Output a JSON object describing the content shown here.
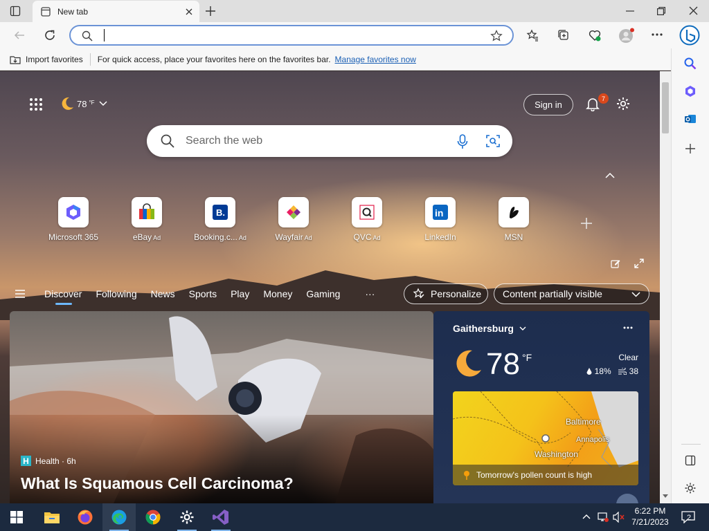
{
  "browser": {
    "tab_title": "New tab",
    "address_placeholder": "",
    "favorites_bar": {
      "import_label": "Import favorites",
      "hint": "For quick access, place your favorites here on the favorites bar.",
      "manage_link": "Manage favorites now"
    }
  },
  "newtab": {
    "weather_chip": "78",
    "weather_unit": "°F",
    "sign_in": "Sign in",
    "notification_count": "7",
    "search_placeholder": "Search the web",
    "quick_links": [
      {
        "name": "Microsoft 365",
        "ad": ""
      },
      {
        "name": "eBay",
        "ad": "Ad"
      },
      {
        "name": "Booking.c...",
        "ad": "Ad"
      },
      {
        "name": "Wayfair",
        "ad": "Ad"
      },
      {
        "name": "QVC",
        "ad": "Ad"
      },
      {
        "name": "LinkedIn",
        "ad": ""
      },
      {
        "name": "MSN",
        "ad": ""
      }
    ],
    "nav": [
      "Discover",
      "Following",
      "News",
      "Sports",
      "Play",
      "Money",
      "Gaming"
    ],
    "more": "···",
    "personalize": "Personalize",
    "content_visibility": "Content partially visible",
    "hero": {
      "source_icon": "H",
      "source": "Health · 6h",
      "title": "What Is Squamous Cell Carcinoma?"
    },
    "weather": {
      "location": "Gaithersburg",
      "temp": "78",
      "unit": "°F",
      "condition": "Clear",
      "precip": "18%",
      "wind": "38",
      "map_labels": [
        "Baltimore",
        "Annapolis",
        "Washington"
      ],
      "pollen": "Tomorrow's pollen count is high"
    }
  },
  "taskbar": {
    "time": "6:22 PM",
    "date": "7/21/2023",
    "notifications": "2"
  },
  "colors": {
    "accent": "#0f6cbd",
    "address_focus": "#6b93d6",
    "taskbar": "#1c2a3f",
    "weather_card": "#1d2d4e"
  }
}
